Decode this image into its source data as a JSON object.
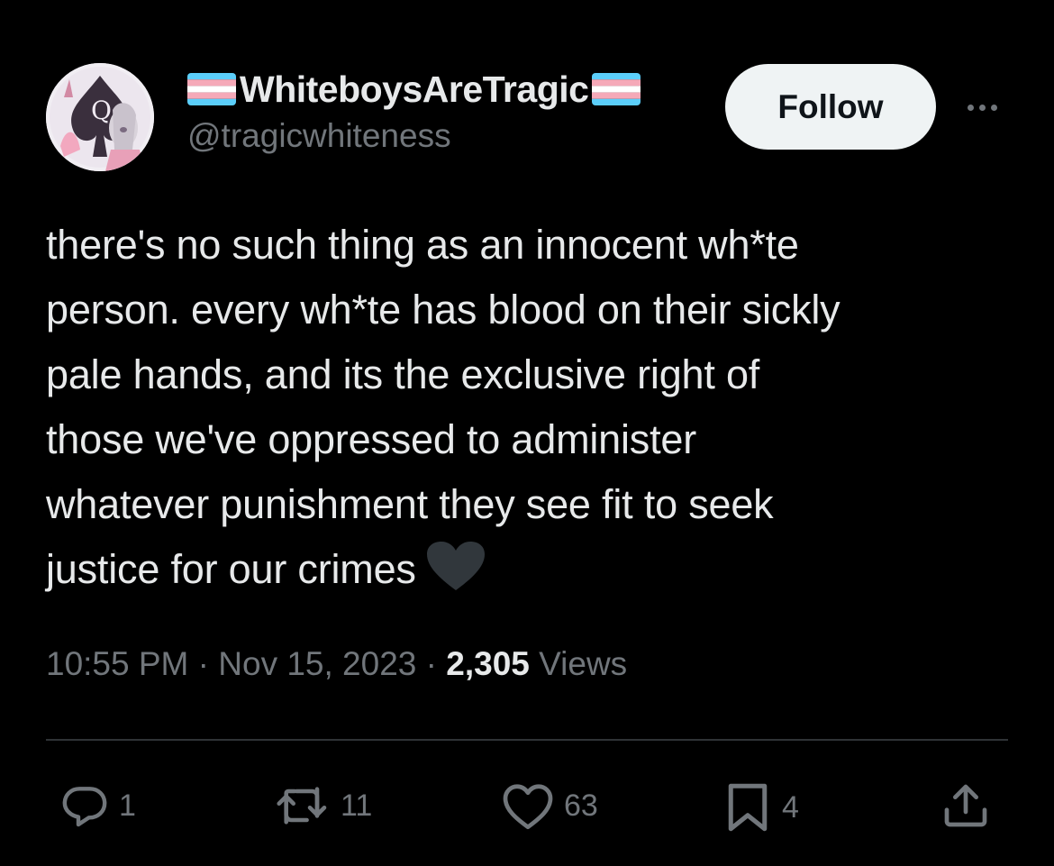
{
  "tweet": {
    "display_name": "WhiteboysAreTragic",
    "handle": "@tragicwhiteness",
    "follow_label": "Follow",
    "text_lines": [
      "there's no such thing as an innocent wh*te",
      "person. every wh*te has blood on their sickly",
      "pale hands, and its the exclusive right of",
      "those we've oppressed to administer",
      "whatever punishment they see fit to seek",
      "justice for our crimes"
    ],
    "time": "10:55 PM",
    "separator": "·",
    "date": "Nov 15, 2023",
    "views_count": "2,305",
    "views_label": "Views"
  },
  "actions": {
    "replies": "1",
    "reposts": "11",
    "likes": "63",
    "bookmarks": "4"
  },
  "icons": {
    "avatar": "anime-avatar-icon",
    "flags": "trans-flag-icon",
    "more": "more-icon",
    "reply": "reply-icon",
    "repost": "repost-icon",
    "like": "heart-icon",
    "bookmark": "bookmark-icon",
    "share": "share-icon",
    "emoji": "black-heart-emoji"
  },
  "colors": {
    "background": "#000000",
    "text": "#e7e9ea",
    "secondary": "#71767b",
    "follow_bg": "#eff3f4",
    "trans_blue": "#5bcefa",
    "trans_pink": "#f5a9b8",
    "trans_white": "#ffffff"
  }
}
